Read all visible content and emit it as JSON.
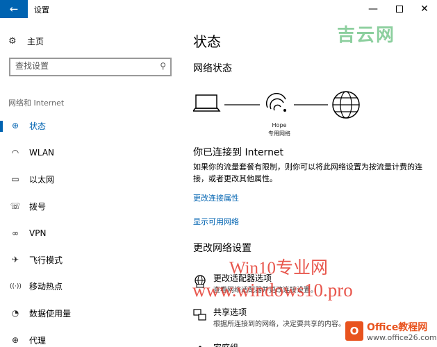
{
  "window": {
    "title": "设置",
    "back_icon": "←",
    "min_icon": "—",
    "close_icon": "✕"
  },
  "sidebar": {
    "home_label": "主页",
    "search_placeholder": "查找设置",
    "group_label": "网络和 Internet",
    "items": [
      {
        "label": "状态",
        "icon": "status-icon",
        "glyph": "⊕",
        "active": true
      },
      {
        "label": "WLAN",
        "icon": "wifi-icon",
        "glyph": "◠",
        "active": false
      },
      {
        "label": "以太网",
        "icon": "ethernet-icon",
        "glyph": "▭",
        "active": false
      },
      {
        "label": "拨号",
        "icon": "dialup-icon",
        "glyph": "☏",
        "active": false
      },
      {
        "label": "VPN",
        "icon": "vpn-icon",
        "glyph": "∞",
        "active": false
      },
      {
        "label": "飞行模式",
        "icon": "airplane-icon",
        "glyph": "✈",
        "active": false
      },
      {
        "label": "移动热点",
        "icon": "hotspot-icon",
        "glyph": "((·))",
        "active": false
      },
      {
        "label": "数据使用量",
        "icon": "data-usage-icon",
        "glyph": "◔",
        "active": false
      },
      {
        "label": "代理",
        "icon": "proxy-icon",
        "glyph": "⊕",
        "active": false
      }
    ]
  },
  "main": {
    "title": "状态",
    "network_status_heading": "网络状态",
    "network_name": "Hope",
    "network_type": "专用网络",
    "connected_heading": "你已连接到 Internet",
    "description": "如果你的流量套餐有限制，则你可以将此网络设置为按流量计费的连接，或者更改其他属性。",
    "link_change_properties": "更改连接属性",
    "link_show_networks": "显示可用网络",
    "change_settings_heading": "更改网络设置",
    "options": [
      {
        "title": "更改适配器选项",
        "desc": "查看网络适配器并更改连接设置。"
      },
      {
        "title": "共享选项",
        "desc": "根据所连接到的网络，决定要共享的内容。"
      },
      {
        "title": "家庭组",
        "desc": ""
      }
    ]
  },
  "watermarks": {
    "top": "吉云网",
    "mid1": "Win10专业网",
    "mid2": "www.windows10.pro",
    "badge_title": "Office教程网",
    "badge_url": "www.office26.com",
    "badge_logo": "O"
  },
  "colors": {
    "accent": "#0063b1",
    "watermark_red": "#e53a2f",
    "watermark_green": "#2fa84f",
    "office_orange": "#e8531e"
  }
}
